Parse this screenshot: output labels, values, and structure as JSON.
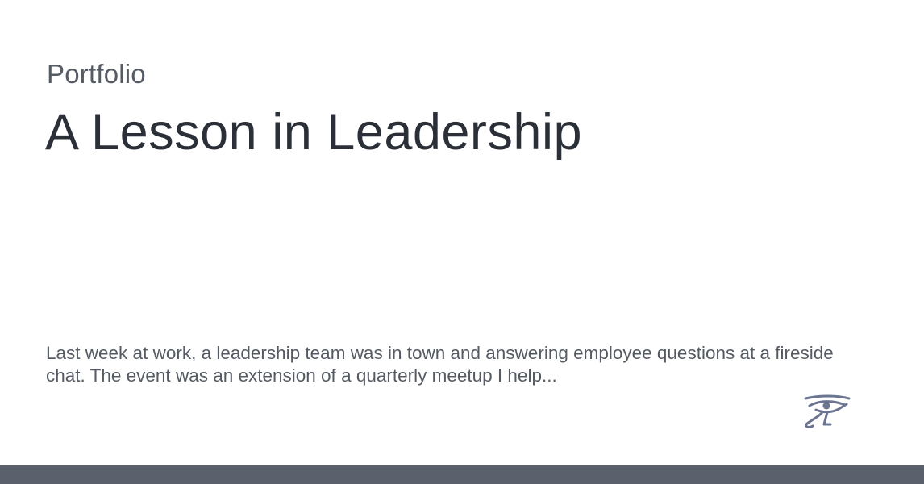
{
  "site": {
    "label": "Portfolio"
  },
  "post": {
    "title": "A Lesson in Leadership",
    "excerpt": "Last week at work, a leadership team was in town and answering employee questions at a fireside chat. The event was an extension of a quarterly meetup I help..."
  },
  "logo": {
    "icon": "eye-of-horus-icon",
    "color": "#6b7490"
  },
  "colors": {
    "title": "#2b3038",
    "text": "#555b64",
    "footer_bar": "#5b616c",
    "background": "#ffffff"
  }
}
